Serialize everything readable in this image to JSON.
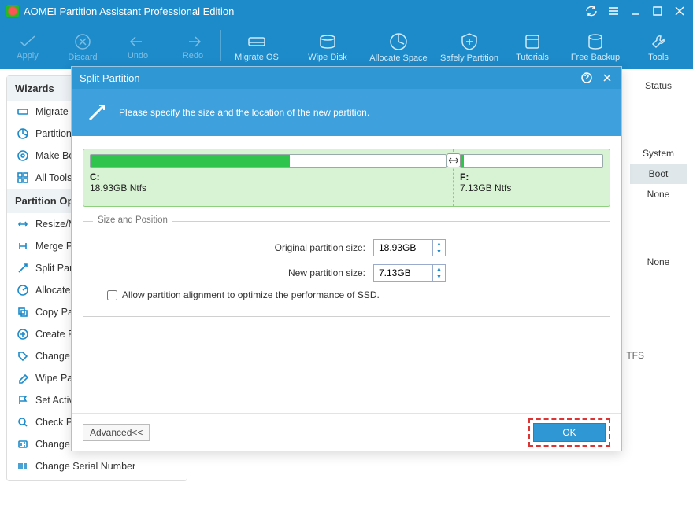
{
  "titlebar": {
    "title": "AOMEI Partition Assistant Professional Edition"
  },
  "toolbar": {
    "apply": "Apply",
    "discard": "Discard",
    "undo": "Undo",
    "redo": "Redo",
    "migrate": "Migrate OS",
    "wipe": "Wipe Disk",
    "allocate": "Allocate Space",
    "safely": "Safely Partition",
    "tutorials": "Tutorials",
    "backup": "Free Backup",
    "tools": "Tools"
  },
  "left": {
    "wizards_head": "Wizards",
    "wizards": [
      {
        "label": "Migrate OS"
      },
      {
        "label": "Partition"
      },
      {
        "label": "Make Bo"
      },
      {
        "label": "All Tools"
      }
    ],
    "ops_head": "Partition Op",
    "ops": [
      {
        "label": "Resize/M"
      },
      {
        "label": "Merge P"
      },
      {
        "label": "Split Par"
      },
      {
        "label": "Allocate"
      },
      {
        "label": "Copy Pa"
      },
      {
        "label": "Create P"
      },
      {
        "label": "Change"
      },
      {
        "label": "Wipe Pa"
      },
      {
        "label": "Set Activ"
      },
      {
        "label": "Check Pa"
      },
      {
        "label": "Change Partition Type ID"
      },
      {
        "label": "Change Serial Number"
      }
    ]
  },
  "right": {
    "head": "Status",
    "cells": [
      "System",
      "Boot",
      "None",
      "None"
    ]
  },
  "ghost": "TFS",
  "modal": {
    "title": "Split Partition",
    "banner": "Please specify the size and the location of the new partition.",
    "left_label": "C:",
    "left_sub": "18.93GB Ntfs",
    "right_label": "F:",
    "right_sub": "7.13GB Ntfs",
    "legend": "Size and Position",
    "orig_label": "Original partition size:",
    "orig_val": "18.93GB",
    "new_label": "New partition size:",
    "new_val": "7.13GB",
    "check_label": "Allow partition alignment to optimize the performance of SSD.",
    "advanced": "Advanced<<",
    "ok": "OK"
  }
}
